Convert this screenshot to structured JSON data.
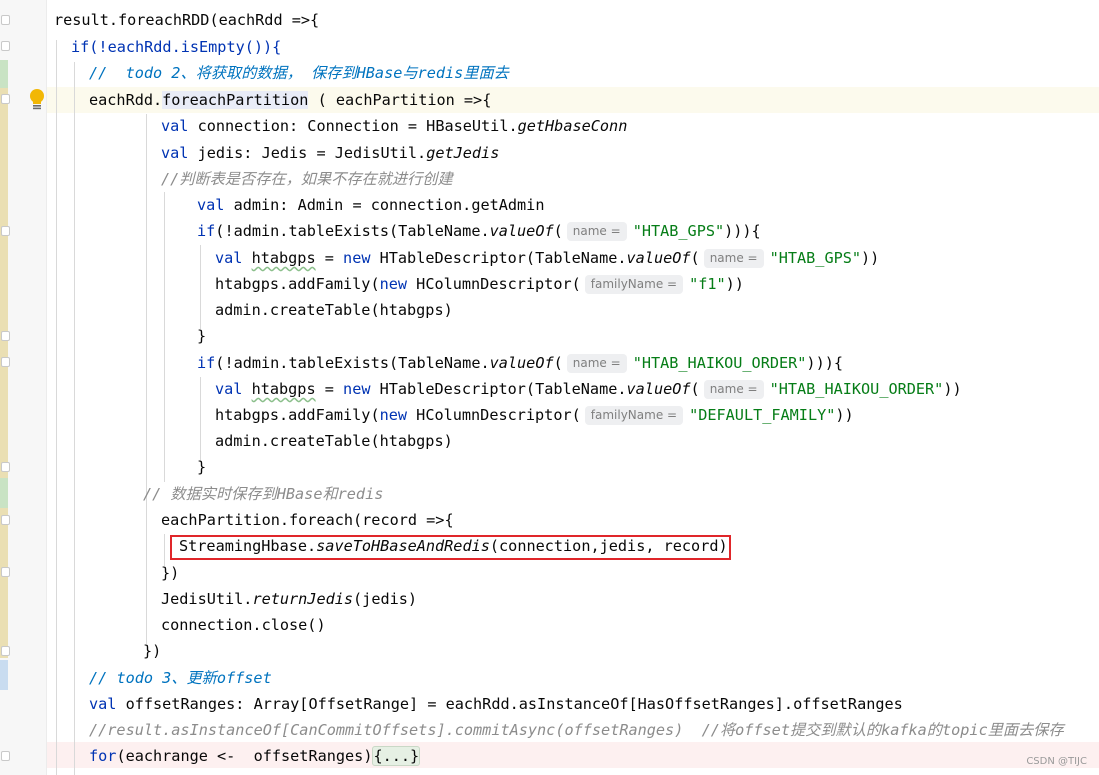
{
  "lines": {
    "l1": "result.foreachRDD(eachRdd =>{",
    "l2": "if(!eachRdd.isEmpty()){",
    "l3_a": "//  ",
    "l3_b": "todo 2、将获取的数据， 保存到HBase与redis里面去",
    "l4_a": "eachRdd.",
    "l4_b": "foreachPartition",
    "l4_c": " ( eachPartition =>{",
    "l5_a": "val",
    "l5_b": " connection: Connection = HBaseUtil.",
    "l5_c": "getHbaseConn",
    "l6_a": "val",
    "l6_b": " jedis: Jedis = JedisUtil.",
    "l6_c": "getJedis",
    "l7": "//判断表是否存在，如果不存在就进行创建",
    "l8_a": "val",
    "l8_b": " admin: Admin = connection.getAdmin",
    "l9_a": "if",
    "l9_b": "(!admin.tableExists(TableName.",
    "l9_c": "valueOf",
    "l9_d": "(",
    "l9_hint": "name =",
    "l9_str": "\"HTAB_GPS\"",
    "l9_e": "))){",
    "l10_a": "val",
    "l10_b": "htabgps",
    "l10_c": " = ",
    "l10_d": "new",
    "l10_e": " HTableDescriptor(TableName.",
    "l10_f": "valueOf",
    "l10_g": "(",
    "l10_hint": "name =",
    "l10_str": "\"HTAB_GPS\"",
    "l10_h": "))",
    "l11_a": "htabgps.addFamily(",
    "l11_b": "new",
    "l11_c": " HColumnDescriptor(",
    "l11_hint": "familyName =",
    "l11_str": "\"f1\"",
    "l11_d": "))",
    "l12": "admin.createTable(htabgps)",
    "l13": "}",
    "l14_a": "if",
    "l14_b": "(!admin.tableExists(TableName.",
    "l14_c": "valueOf",
    "l14_d": "(",
    "l14_hint": "name =",
    "l14_str": "\"HTAB_HAIKOU_ORDER\"",
    "l14_e": "))){",
    "l15_a": "val",
    "l15_b": "htabgps",
    "l15_c": " = ",
    "l15_d": "new",
    "l15_e": " HTableDescriptor(TableName.",
    "l15_f": "valueOf",
    "l15_g": "(",
    "l15_hint": "name =",
    "l15_str": "\"HTAB_HAIKOU_ORDER\"",
    "l15_h": "))",
    "l16_a": "htabgps.addFamily(",
    "l16_b": "new",
    "l16_c": " HColumnDescriptor(",
    "l16_hint": "familyName =",
    "l16_str": "\"DEFAULT_FAMILY\"",
    "l16_d": "))",
    "l17": "admin.createTable(htabgps)",
    "l18": "}",
    "l19": "// 数据实时保存到HBase和redis",
    "l20": "eachPartition.foreach(record =>{",
    "l21_a": "StreamingHbase.",
    "l21_b": "saveToHBaseAndRedis",
    "l21_c": "(connection,jedis, record)",
    "l22": "})",
    "l23_a": "JedisUtil.",
    "l23_b": "returnJedis",
    "l23_c": "(jedis)",
    "l24": "connection.close()",
    "l25": "})",
    "l26_a": "// ",
    "l26_b": "todo 3、更新offset",
    "l27_a": "val",
    "l27_b": " offsetRanges: Array[OffsetRange] = eachRdd.asInstanceOf[HasOffsetRanges].offsetRanges",
    "l28": "//result.asInstanceOf[CanCommitOffsets].commitAsync(offsetRanges)  //将offset提交到默认的kafka的topic里面去保存",
    "l29_a": "for",
    "l29_b": "(eachrange <-  offsetRanges)",
    "l29_c": "{...}"
  },
  "watermark": "CSDN @TIJC",
  "colors": {
    "keyword": "#0033b3",
    "string": "#067d17",
    "comment": "#8c8c8c",
    "todo": "#0073bf",
    "highlight_box": "#e0262a"
  },
  "icons": [
    "intention-bulb-icon"
  ]
}
